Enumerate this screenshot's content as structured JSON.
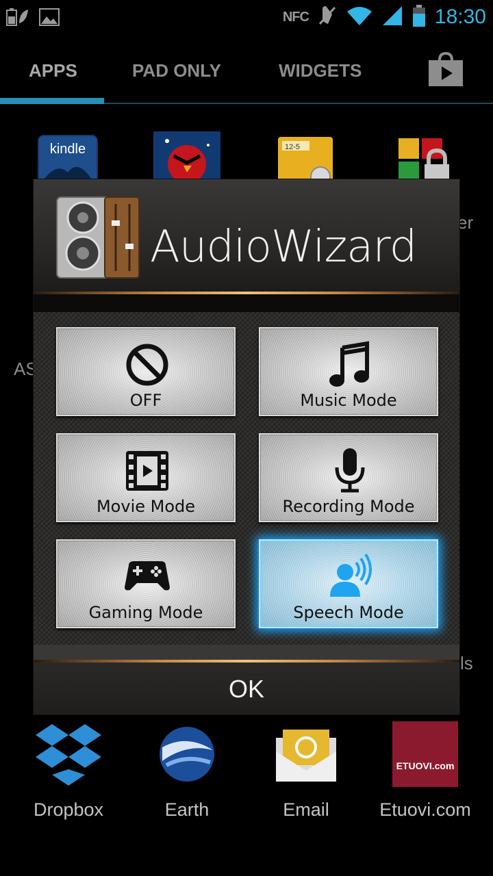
{
  "status_bar": {
    "time": "18:30",
    "nfc_label": "NFC",
    "icons": [
      "battery-leaf-icon",
      "image-notification-icon",
      "nfc-icon",
      "muted-icon",
      "wifi-icon",
      "signal-icon",
      "battery-icon"
    ]
  },
  "tabs": {
    "apps": "APPS",
    "pad_only": "PAD ONLY",
    "widgets": "WIDGETS",
    "selected": "APPS"
  },
  "drawer": {
    "top_apps": [
      "kindle-icon",
      "angry-birds-icon",
      "file-manager-icon",
      "app-locker-icon"
    ],
    "kindle_text": "kindle",
    "file_text": "12-5",
    "behind_fragment_right_1": "er",
    "behind_fragment_left": "AS",
    "behind_fragment_right_2": "ls",
    "bottom_apps": [
      {
        "label": "Dropbox",
        "icon": "dropbox-icon"
      },
      {
        "label": "Earth",
        "icon": "earth-icon"
      },
      {
        "label": "Email",
        "icon": "email-icon"
      },
      {
        "label": "Etuovi.com",
        "icon": "etuovi-icon",
        "icon_text": "ETUOVI.com"
      }
    ]
  },
  "dialog": {
    "title": "AudioWizard",
    "modes": [
      {
        "label": "OFF",
        "icon": "off-icon"
      },
      {
        "label": "Music Mode",
        "icon": "music-note-icon"
      },
      {
        "label": "Movie Mode",
        "icon": "film-play-icon"
      },
      {
        "label": "Recording Mode",
        "icon": "microphone-icon"
      },
      {
        "label": "Gaming Mode",
        "icon": "gamepad-icon"
      },
      {
        "label": "Speech Mode",
        "icon": "speech-person-icon"
      }
    ],
    "selected_mode": "Speech Mode",
    "ok": "OK"
  },
  "colors": {
    "accent_blue": "#33b5e5",
    "tab_indicator": "#268fb8",
    "selected_glow": "#1aa7ff",
    "copper_rule": "#c98a4a"
  }
}
